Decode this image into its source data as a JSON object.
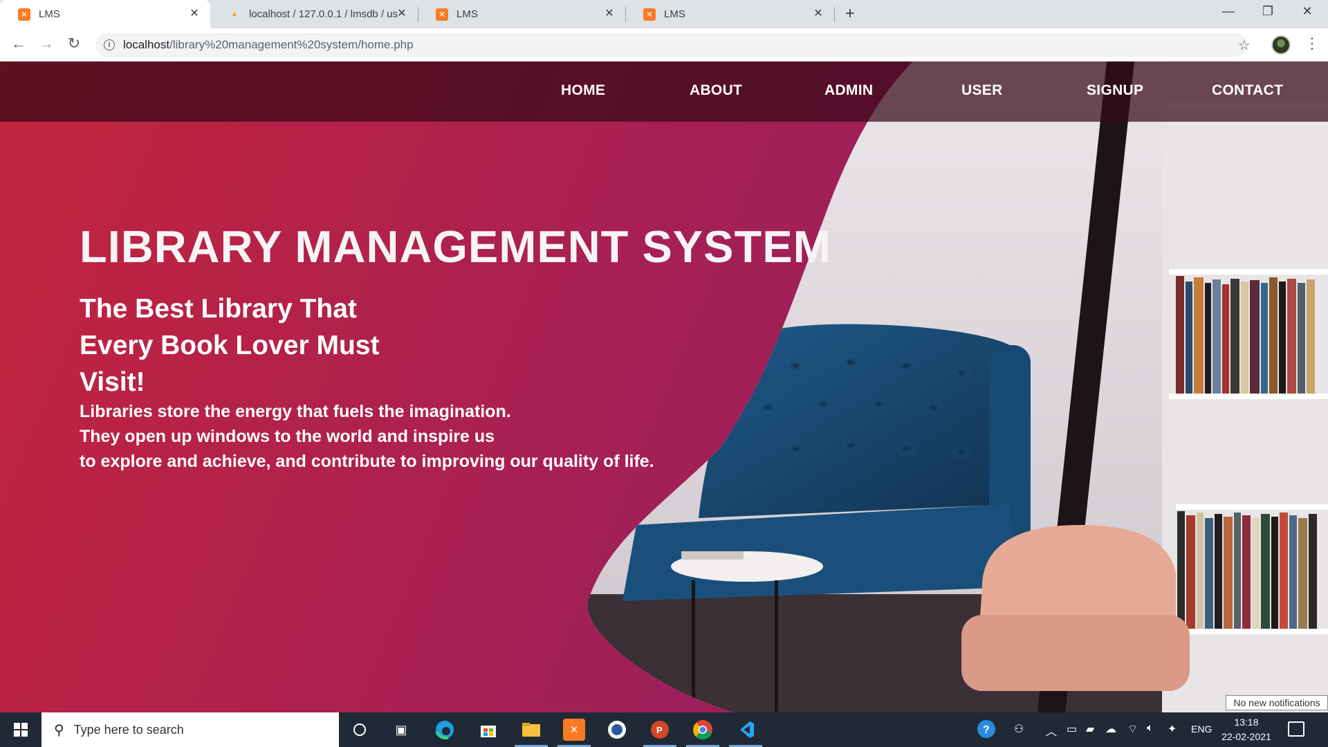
{
  "browser": {
    "tabs": [
      {
        "title": "LMS",
        "icon": "xampp-icon",
        "active": true
      },
      {
        "title": "localhost / 127.0.0.1 / lmsdb / us",
        "icon": "phpmyadmin-icon",
        "active": false
      },
      {
        "title": "LMS",
        "icon": "xampp-icon",
        "active": false
      },
      {
        "title": "LMS",
        "icon": "xampp-icon",
        "active": false
      }
    ],
    "url_host": "localhost",
    "url_path": "/library%20management%20system/home.php"
  },
  "nav": {
    "home": "HOME",
    "about": "ABOUT",
    "admin": "ADMIN",
    "user": "USER",
    "signup": "SIGNUP",
    "contact": "CONTACT"
  },
  "hero": {
    "title": "LIBRARY MANAGEMENT SYSTEM",
    "subtitle_line1": "The Best Library That",
    "subtitle_line2": "Every Book Lover Must",
    "subtitle_line3": "Visit!",
    "quote_line1": "Libraries store the energy that fuels the imagination.",
    "quote_line2": "They open up windows to the world and inspire us",
    "quote_line3": "to explore and achieve, and contribute to improving our quality of life."
  },
  "notification_toast": "No new notifications",
  "taskbar": {
    "search_placeholder": "Type here to search",
    "language": "ENG",
    "time": "13:18",
    "date": "22-02-2021"
  },
  "colors": {
    "nav_bar": "#3a0a1c",
    "hero_gradient_left": "#c0233f",
    "hero_gradient_right": "#8f1f5a",
    "sofa": "#1c4c78",
    "taskbar": "#1f2a36"
  }
}
